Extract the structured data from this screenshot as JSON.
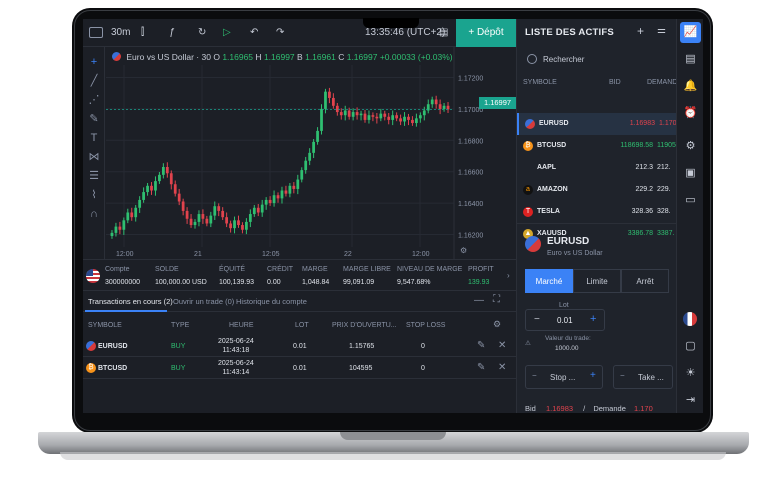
{
  "topbar": {
    "timeframe": "30m",
    "clock": "13:35:46 (UTC+2)",
    "deposit_label": "+ Dépôt"
  },
  "chart": {
    "title_prefix": "Euro vs US Dollar · 30",
    "o_label": "O",
    "o_value": "1.16965",
    "h_label": "H",
    "h_value": "1.16997",
    "b_label": "B",
    "b_value": "1.16961",
    "c_label": "C",
    "c_value": "1.16997",
    "change": "+0.00033 (+0.03%)",
    "price_tag": "1.16997"
  },
  "chart_data": {
    "type": "candlestick",
    "y_ticks": [
      "1.17200",
      "1.17000",
      "1.16800",
      "1.16600",
      "1.16400",
      "1.16200"
    ],
    "x_ticks": [
      "12:00",
      "21",
      "12:05",
      "22",
      "12:00"
    ],
    "ylim": [
      1.1612,
      1.1728
    ],
    "closes": [
      1.1621,
      1.1625,
      1.1623,
      1.1629,
      1.1634,
      1.1631,
      1.1637,
      1.1642,
      1.1647,
      1.1651,
      1.1648,
      1.1654,
      1.1658,
      1.1663,
      1.1659,
      1.1652,
      1.1646,
      1.1641,
      1.1635,
      1.163,
      1.1626,
      1.1628,
      1.1633,
      1.163,
      1.1627,
      1.1632,
      1.1638,
      1.1635,
      1.1631,
      1.1627,
      1.1624,
      1.1629,
      1.1626,
      1.1623,
      1.1628,
      1.1633,
      1.1637,
      1.1634,
      1.1639,
      1.1642,
      1.164,
      1.1645,
      1.1643,
      1.1648,
      1.1646,
      1.1651,
      1.1649,
      1.1655,
      1.1661,
      1.1667,
      1.1672,
      1.1679,
      1.1686,
      1.17,
      1.1711,
      1.1707,
      1.1702,
      1.1698,
      1.1696,
      1.1699,
      1.1695,
      1.1698,
      1.1696,
      1.1697,
      1.1693,
      1.1696,
      1.1695,
      1.1694,
      1.1697,
      1.1695,
      1.1693,
      1.1696,
      1.1694,
      1.1692,
      1.1695,
      1.1693,
      1.1691,
      1.1694,
      1.1696,
      1.1699,
      1.1703,
      1.1706,
      1.1703,
      1.17,
      1.1702,
      1.16997
    ]
  },
  "account": {
    "compte_label": "Compte",
    "compte": "300000000",
    "solde_label": "SOLDE",
    "solde": "100,000.00 USD",
    "equite_label": "ÉQUITÉ",
    "equite": "100,139.93",
    "credit_label": "CRÉDIT",
    "credit": "0.00",
    "marge_label": "MARGE",
    "marge": "1,048.84",
    "marge_libre_label": "MARGE LIBRE",
    "marge_libre": "99,091.09",
    "niveau_label": "NIVEAU DE MARGE",
    "niveau": "9,547.68%",
    "profit_label": "PROFIT",
    "profit": "139.93"
  },
  "tabs": [
    "Transactions en cours (2)",
    "Ouvrir un trade (0)",
    "Historique du compte"
  ],
  "trades": {
    "headers": [
      "SYMBOLE",
      "TYPE",
      "HEURE",
      "LOT",
      "PRIX D'OUVERTU...",
      "STOP LOSS"
    ],
    "rows": [
      {
        "symbol": "EURUSD",
        "type": "BUY",
        "date": "2025-06-24",
        "time": "11:43:18",
        "lot": "0.01",
        "price": "1.15765",
        "sl": "0"
      },
      {
        "symbol": "BTCUSD",
        "type": "BUY",
        "date": "2025-06-24",
        "time": "11:43:14",
        "lot": "0.01",
        "price": "104595",
        "sl": "0"
      }
    ]
  },
  "assets": {
    "title": "LISTE DES ACTIFS",
    "search_placeholder": "Rechercher",
    "col_symbol": "SYMBOLE",
    "col_bid": "BID",
    "col_ask": "DEMANDE",
    "rows": [
      {
        "name": "EURUSD",
        "bid": "1.16983",
        "ask": "1.170",
        "icon": "eurusd-icon",
        "bid_color": "#e0434d",
        "ask_color": "#e0434d"
      },
      {
        "name": "BTCUSD",
        "bid": "118698.58",
        "ask": "11905",
        "icon": "bitcoin-icon",
        "bid_color": "#2fbf71",
        "ask_color": "#2fbf71"
      },
      {
        "name": "AAPL",
        "bid": "212.3",
        "ask": "212.",
        "icon": "apple-icon",
        "bid_color": "#dfe3ea",
        "ask_color": "#dfe3ea"
      },
      {
        "name": "AMAZON",
        "bid": "229.2",
        "ask": "229.",
        "icon": "amazon-icon",
        "bid_color": "#dfe3ea",
        "ask_color": "#dfe3ea"
      },
      {
        "name": "TESLA",
        "bid": "328.36",
        "ask": "328.",
        "icon": "tesla-icon",
        "bid_color": "#dfe3ea",
        "ask_color": "#dfe3ea"
      },
      {
        "name": "XAUUSD",
        "bid": "3386.78",
        "ask": "3387.",
        "icon": "gold-icon",
        "bid_color": "#2fbf71",
        "ask_color": "#2fbf71"
      }
    ]
  },
  "order": {
    "symbol": "EURUSD",
    "description": "Euro vs US Dollar",
    "segments": [
      "Marché",
      "Limite",
      "Arrêt"
    ],
    "lot_label": "Lot",
    "lot_value": "0.01",
    "trade_value_label": "Valeur du trade:",
    "trade_value": "1000.00",
    "stop_label": "Stop ...",
    "take_label": "Take ...",
    "bid_label": "Bid",
    "bid_value": "1.16983",
    "ask_label": "Demande",
    "ask_value": "1.170"
  }
}
